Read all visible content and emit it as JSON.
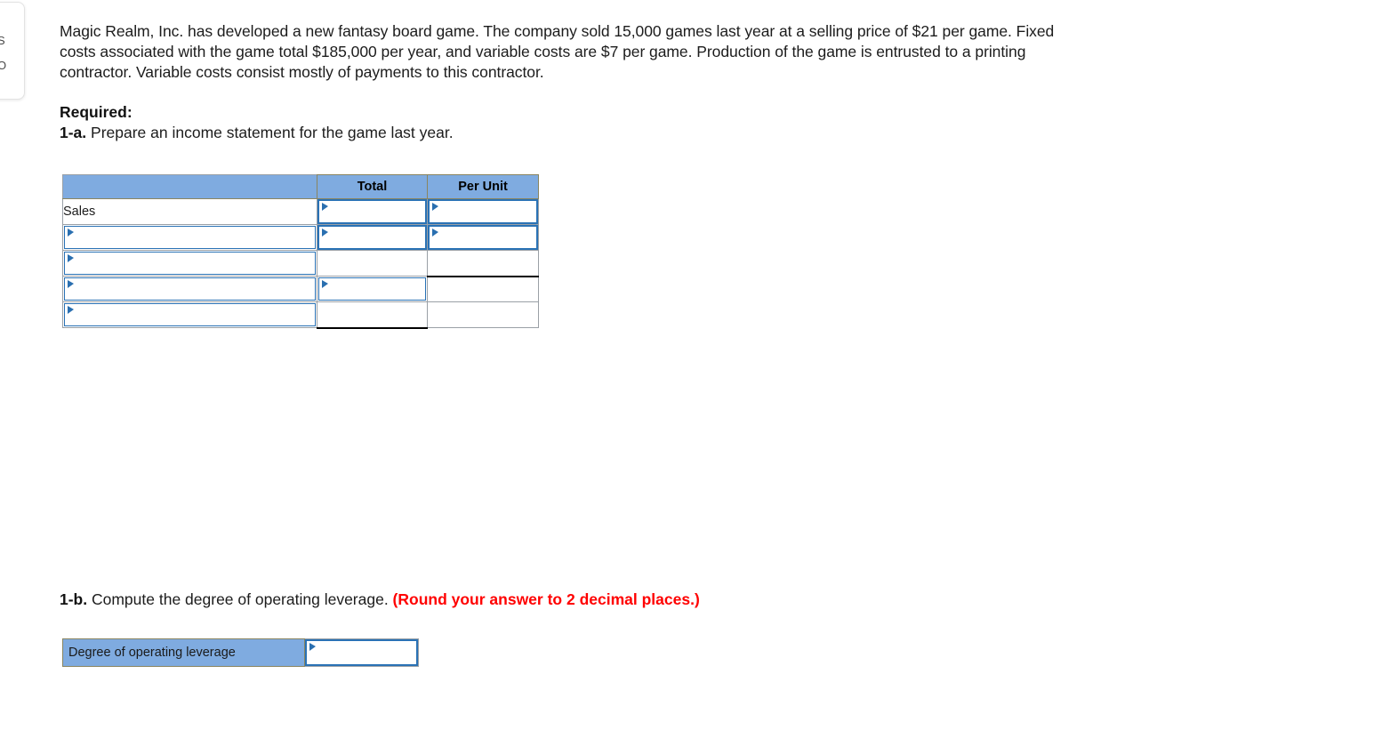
{
  "side_panel": {
    "glyph_top": "S",
    "glyph_bottom": "O"
  },
  "question": {
    "prompt": "Magic Realm, Inc. has developed a new fantasy board game. The company sold 15,000 games last year at a selling price of $21 per game. Fixed costs associated with the game total $185,000 per year, and variable costs are $7 per game. Production of the game is entrusted to a printing contractor. Variable costs consist mostly of payments to this contractor.",
    "required_label": "Required:",
    "part_a": {
      "tag": "1-a.",
      "text": " Prepare an income statement for the game last year."
    },
    "part_b": {
      "tag": "1-b.",
      "text": " Compute the degree of operating leverage. ",
      "round_note": "(Round your answer to 2 decimal places.)"
    }
  },
  "income_statement": {
    "headers": {
      "label": "",
      "total": "Total",
      "per_unit": "Per Unit"
    },
    "rows": [
      {
        "label": "Sales",
        "label_value": "Sales",
        "label_kind": "text",
        "total_kind": "input",
        "total_value": "",
        "per_unit_kind": "input",
        "per_unit_value": ""
      },
      {
        "label": "",
        "label_value": "",
        "label_kind": "input",
        "total_kind": "input",
        "total_value": "",
        "per_unit_kind": "input",
        "per_unit_value": ""
      },
      {
        "label": "",
        "label_value": "",
        "label_kind": "input",
        "total_kind": "blank",
        "total_value": "",
        "per_unit_kind": "blank-underline",
        "per_unit_value": ""
      },
      {
        "label": "",
        "label_value": "",
        "label_kind": "input",
        "total_kind": "input",
        "total_value": "",
        "per_unit_kind": "blank",
        "per_unit_value": ""
      },
      {
        "label": "",
        "label_value": "",
        "label_kind": "input",
        "total_kind": "blank-underline",
        "total_value": "",
        "per_unit_kind": "blank",
        "per_unit_value": ""
      }
    ]
  },
  "operating_leverage": {
    "label": "Degree of operating leverage",
    "value": "",
    "placeholder": ""
  },
  "colors": {
    "header_blue": "#7FABE0",
    "selection_blue": "#2a72b5",
    "alert_red": "#ff0000",
    "grid_gray": "#9aa0a6"
  },
  "icons": {
    "dropdown_triangle": "dropdown-triangle-icon"
  }
}
